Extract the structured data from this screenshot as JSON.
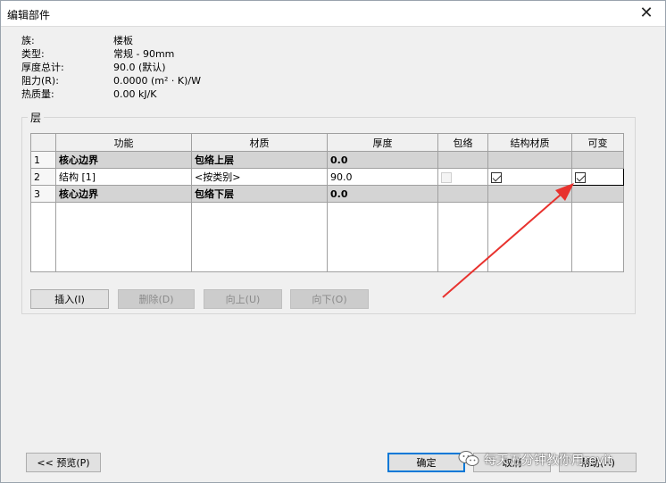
{
  "window": {
    "title": "编辑部件",
    "close_glyph": "✕"
  },
  "properties": [
    {
      "label": "族:",
      "value": "楼板"
    },
    {
      "label": "类型:",
      "value": "常规 - 90mm"
    },
    {
      "label": "厚度总计:",
      "value": "90.0 (默认)"
    },
    {
      "label": "阻力(R):",
      "value": "0.0000 (m² · K)/W"
    },
    {
      "label": "热质量:",
      "value": "0.00 kJ/K"
    }
  ],
  "layers": {
    "group_label": "层",
    "columns": [
      "",
      "功能",
      "材质",
      "厚度",
      "包络",
      "结构材质",
      "可变"
    ],
    "rows": [
      {
        "num": "1",
        "function": "核心边界",
        "material": "包络上层",
        "thickness": "0.0"
      },
      {
        "num": "2",
        "function": "结构 [1]",
        "material": "<按类别>",
        "thickness": "90.0",
        "wrap": false,
        "structural": true,
        "variable": true
      },
      {
        "num": "3",
        "function": "核心边界",
        "material": "包络下层",
        "thickness": "0.0"
      }
    ]
  },
  "buttons": {
    "insert": "插入(I)",
    "delete": "删除(D)",
    "up": "向上(U)",
    "down": "向下(O)",
    "preview": "<< 预览(P)",
    "ok": "确定",
    "cancel": "取消",
    "help": "帮助(H)"
  },
  "watermark": {
    "text": "每天五分钟教你用revit",
    "icon": "wechat-icon"
  },
  "annotation_color": "#e8322e"
}
